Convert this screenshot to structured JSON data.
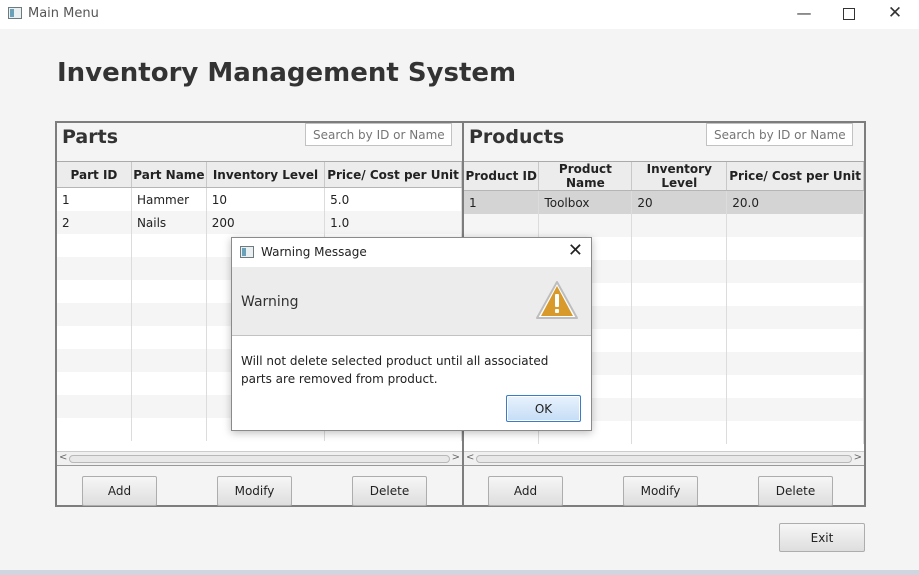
{
  "window": {
    "title": "Main Menu",
    "minimize": "—",
    "close": "✕"
  },
  "heading": "Inventory Management System",
  "parts": {
    "title": "Parts",
    "search_placeholder": "Search by ID or Name",
    "columns": [
      "Part ID",
      "Part Name",
      "Inventory Level",
      "Price/ Cost per Unit"
    ],
    "rows": [
      [
        "1",
        "Hammer",
        "10",
        "5.0"
      ],
      [
        "2",
        "Nails",
        "200",
        "1.0"
      ]
    ],
    "buttons": {
      "add": "Add",
      "modify": "Modify",
      "delete": "Delete"
    }
  },
  "products": {
    "title": "Products",
    "search_placeholder": "Search by ID or Name",
    "columns": [
      "Product ID",
      "Product Name",
      "Inventory Level",
      "Price/ Cost per Unit"
    ],
    "rows": [
      [
        "1",
        "Toolbox",
        "20",
        "20.0"
      ]
    ],
    "buttons": {
      "add": "Add",
      "modify": "Modify",
      "delete": "Delete"
    }
  },
  "exit_label": "Exit",
  "dialog": {
    "title": "Warning Message",
    "close": "✕",
    "header": "Warning",
    "message": "Will not delete selected product until all associated parts are removed from product.",
    "ok_label": "OK",
    "icon": "warning-icon",
    "icon_color": "#d89a2b"
  }
}
